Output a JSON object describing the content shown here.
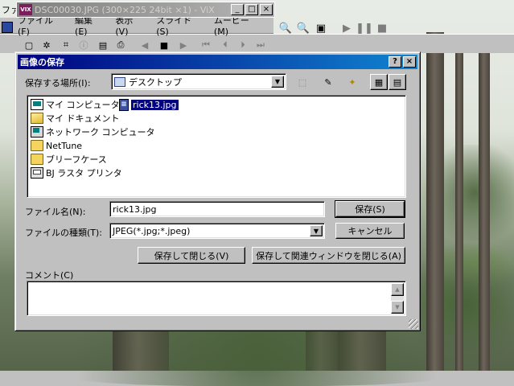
{
  "background_app": {
    "top_left_label": "ファ",
    "title": "DSC00030.JPG (300×225 24bit ×1) - ViX",
    "logo_text": "VIX",
    "menu": [
      "ファイル(F)",
      "編集(E)",
      "表示(V)",
      "スライド(S)",
      "ムービー(M)"
    ]
  },
  "dialog": {
    "title": "画像の保存",
    "help_btn": "?",
    "close_btn": "×",
    "location_label": "保存する場所(I):",
    "location_value": "デスクトップ",
    "items": [
      {
        "name": "マイ コンピュータ",
        "icon": "computer-icon"
      },
      {
        "name": "マイ ドキュメント",
        "icon": "folder-icon"
      },
      {
        "name": "ネットワーク コンピュータ",
        "icon": "network-icon"
      },
      {
        "name": "NetTune",
        "icon": "folder-icon"
      },
      {
        "name": "ブリーフケース",
        "icon": "folder-icon"
      },
      {
        "name": "BJ ラスタ プリンタ",
        "icon": "printer-icon"
      },
      {
        "name": "rick13.jpg",
        "icon": "jpeg-file-icon",
        "selected": true
      }
    ],
    "filename_label": "ファイル名(N):",
    "filename_value": "rick13.jpg",
    "filetype_label": "ファイルの種類(T):",
    "filetype_value": "JPEG(*.jpg;*.jpeg)",
    "save_button": "保存(S)",
    "cancel_button": "キャンセル",
    "save_close_button": "保存して閉じる(V)",
    "save_close_related_button": "保存して関連ウィンドウを閉じる(A)",
    "comment_label": "コメント(C)",
    "comment_value": ""
  }
}
